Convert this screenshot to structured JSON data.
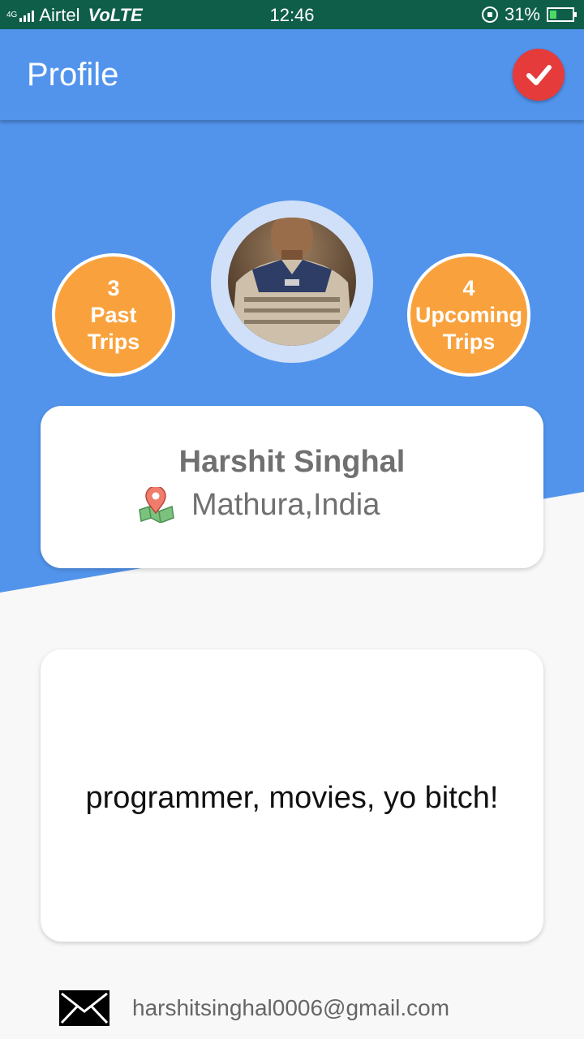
{
  "status_bar": {
    "network": "4G",
    "carrier": "Airtel",
    "volte": "VoLTE",
    "time": "12:46",
    "battery_percent": "31%",
    "battery_level": 0.31
  },
  "app_bar": {
    "title": "Profile",
    "confirm_icon": "check-icon"
  },
  "stats": {
    "past": {
      "count": "3",
      "line1": "Past",
      "line2": "Trips"
    },
    "upcoming": {
      "count": "4",
      "line1": "Upcoming",
      "line2": "Trips"
    }
  },
  "profile": {
    "name": "Harshit Singhal",
    "location": "Mathura,India",
    "location_icon": "map-pin-icon",
    "bio": "programmer, movies, yo bitch!",
    "email": "harshitsinghal0006@gmail.com",
    "email_icon": "envelope-icon"
  },
  "colors": {
    "primary": "#5294ec",
    "accent": "#f9a23d",
    "confirm": "#e53b3b",
    "status_bar": "#0f5e4a"
  }
}
